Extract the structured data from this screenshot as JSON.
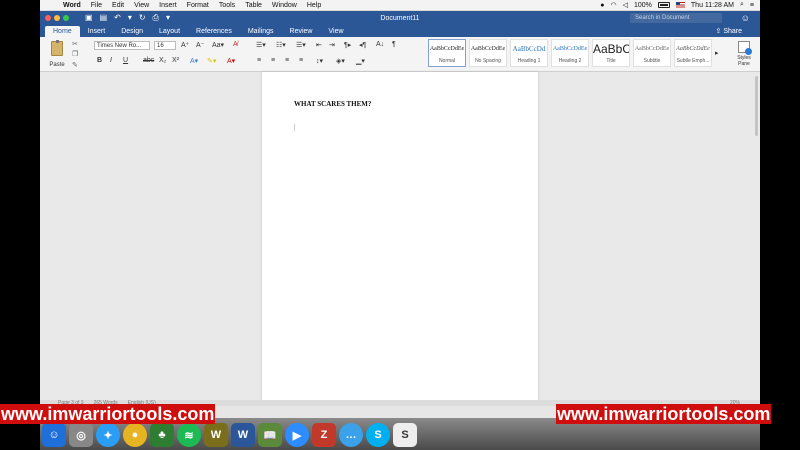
{
  "menubar": {
    "app_name": "Word",
    "menus": [
      "File",
      "Edit",
      "View",
      "Insert",
      "Format",
      "Tools",
      "Table",
      "Window",
      "Help"
    ],
    "battery": "100%",
    "clock": "Thu 11:28 AM"
  },
  "titlebar": {
    "doc_title": "Document11",
    "search_placeholder": "Search in Document"
  },
  "ribbon_tabs": [
    "Home",
    "Insert",
    "Design",
    "Layout",
    "References",
    "Mailings",
    "Review",
    "View"
  ],
  "share_label": "Share",
  "ribbon": {
    "paste_label": "Paste",
    "font_name": "Times New Ro...",
    "font_size": "16",
    "styles": [
      {
        "preview": "AaBbCcDdEe",
        "name": "Normal"
      },
      {
        "preview": "AaBbCcDdEe",
        "name": "No Spacing"
      },
      {
        "preview": "AaBbCcDd",
        "name": "Heading 1"
      },
      {
        "preview": "AaBbCcDdEe",
        "name": "Heading 2"
      },
      {
        "preview": "AaBbC",
        "name": "Title"
      },
      {
        "preview": "AaBbCcDdEe",
        "name": "Subtitle"
      },
      {
        "preview": "AaBbCcDdEe",
        "name": "Subtle Emph..."
      }
    ],
    "styles_pane_label": "Styles Pane"
  },
  "document": {
    "heading": "WHAT SCARES THEM?"
  },
  "statusbar": {
    "page": "Page 3 of 3",
    "words": "265 Words",
    "language": "English (US)",
    "zoom": "20%"
  },
  "watermark_text": "www.imwarriortools.com",
  "colors": {
    "word_blue": "#2b5797",
    "watermark_red": "#cf0d0d"
  }
}
